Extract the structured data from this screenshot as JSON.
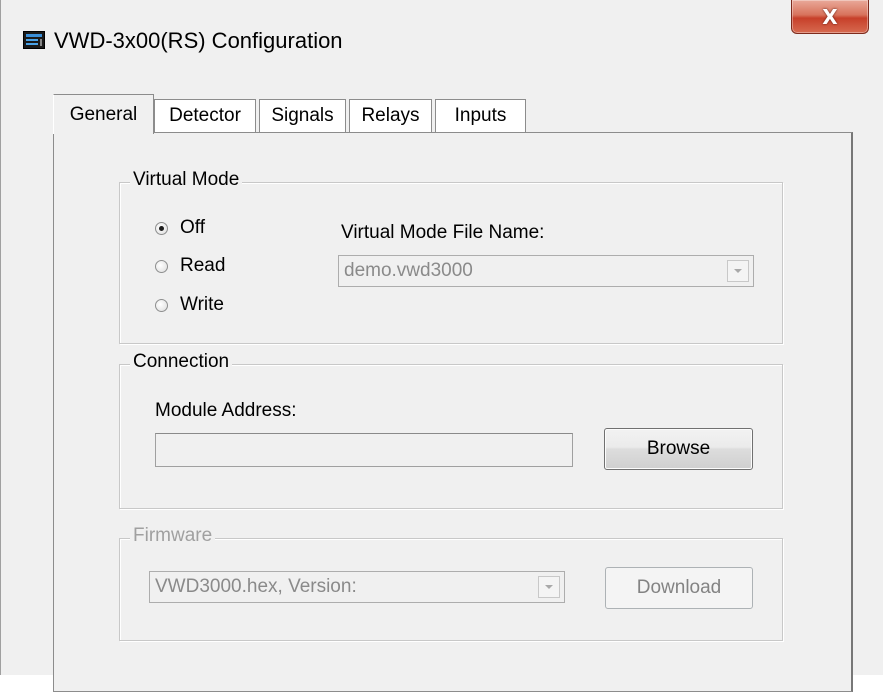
{
  "window": {
    "title": "VWD-3x00(RS) Configuration",
    "close_glyph": "X"
  },
  "tabs": [
    {
      "label": "General",
      "active": true
    },
    {
      "label": "Detector",
      "active": false
    },
    {
      "label": "Signals",
      "active": false
    },
    {
      "label": "Relays",
      "active": false
    },
    {
      "label": "Inputs",
      "active": false
    }
  ],
  "virtual_mode": {
    "group_label": "Virtual Mode",
    "options": [
      {
        "label": "Off",
        "checked": true
      },
      {
        "label": "Read",
        "checked": false
      },
      {
        "label": "Write",
        "checked": false
      }
    ],
    "file_name_label": "Virtual Mode File Name:",
    "file_name_value": "demo.vwd3000"
  },
  "connection": {
    "group_label": "Connection",
    "module_address_label": "Module Address:",
    "module_address_value": "",
    "browse_label": "Browse"
  },
  "firmware": {
    "group_label": "Firmware",
    "file_value": "VWD3000.hex, Version:",
    "download_label": "Download"
  },
  "colors": {
    "window_bg": "#f0f0f0",
    "close_button": "#c7402a",
    "disabled_text": "#838383"
  }
}
